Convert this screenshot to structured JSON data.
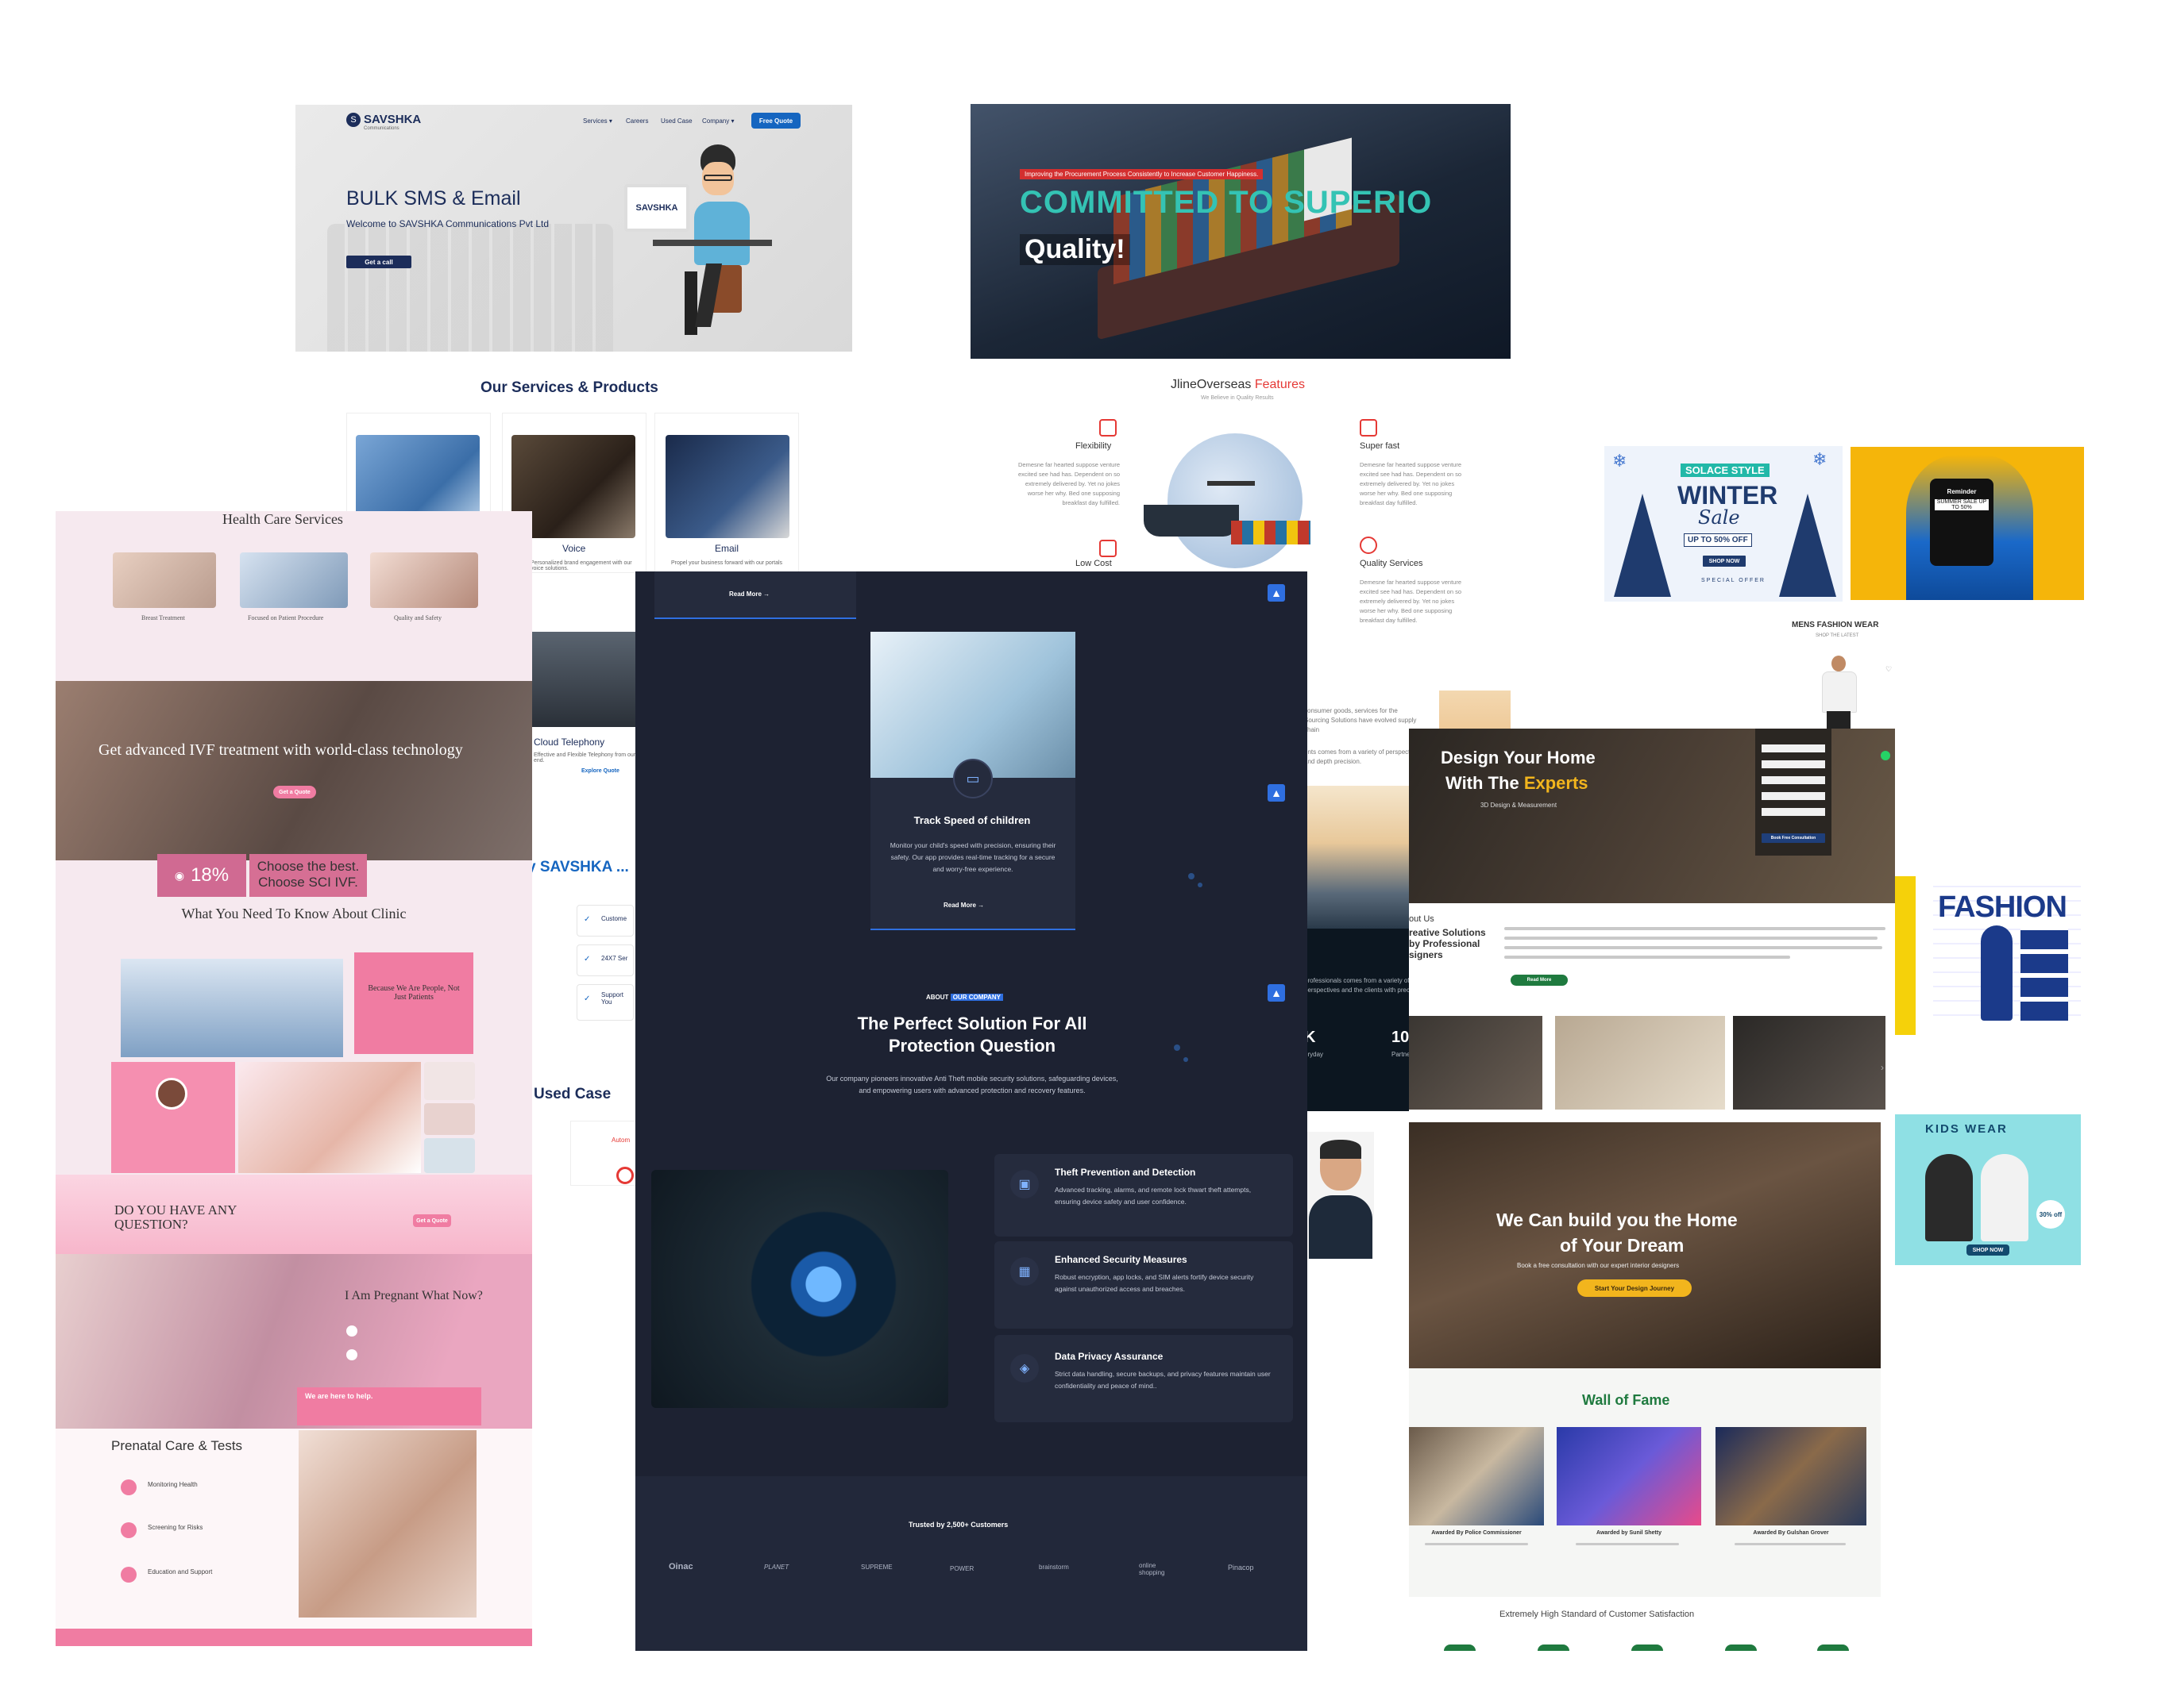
{
  "savshka": {
    "logo": "SAVSHKA",
    "logo_tagline": "Communications",
    "nav": [
      "Services ▾",
      "Careers",
      "Used Case",
      "Company ▾"
    ],
    "cta": "Free Quote",
    "hero_title": "BULK SMS & Email",
    "hero_sub": "Welcome to SAVSHKA Communications Pvt Ltd",
    "hero_btn": "Get a call",
    "monitor_logo": "SAVSHKA",
    "services_title": "Our Services & Products",
    "cards": [
      {
        "title": "Voice",
        "desc": "Personalized brand engagement with our voice solutions.",
        "link": "Explore"
      },
      {
        "title": "Email",
        "desc": "Propel your business forward with our portals"
      }
    ],
    "cloud_title": "Cloud Telephony",
    "cloud_desc": "Effective and Flexible Telephony from our end.",
    "cloud_link": "Explore Quote",
    "why_title": "y SAVSHKA ...",
    "why_items": [
      "Custome",
      "24X7 Ser",
      "Support You"
    ],
    "used_case": "Used Case",
    "auto_label": "Autom"
  },
  "shipping": {
    "badge": "Improving the Procurement Process Consistently to Increase Customer Happiness.",
    "title": "COMMITTED TO SUPERIO",
    "title2": "Quality!",
    "features_brand": "JlineOverseas",
    "features_word": "Features",
    "features_sub": "We Believe in Quality Results",
    "items": [
      {
        "title": "Flexibility",
        "desc": "Demesne far hearted suppose venture excited see had has. Dependent on so extremely delivered by. Yet no jokes worse her why. Bed one supposing breakfast day fulfilled."
      },
      {
        "title": "Super fast",
        "desc": "Demesne far hearted suppose venture excited see had has. Dependent on so extremely delivered by. Yet no jokes worse her why. Bed one supposing breakfast day fulfilled."
      },
      {
        "title": "Quality Services",
        "desc": "Demesne far hearted suppose venture excited see had has. Dependent on so extremely delivered by. Yet no jokes worse her why. Bed one supposing breakfast day fulfilled."
      },
      {
        "title": "Low Cost"
      }
    ],
    "about_text": "consumer goods, services for the Sourcing Solutions have evolved supply chain",
    "about_text2": "ents comes from a variety of perspectives and depth precision.",
    "dark_text": "professionals comes from a variety of perspectives and the clients with precision.",
    "stat_k": "K",
    "stat_k_label": "eryday",
    "stat_10": "10",
    "stat_10_label": "Partner V"
  },
  "health": {
    "title": "Health Care Services",
    "services": [
      "Breast Treatment",
      "Focused on Patient Procedure",
      "Quality and Safety"
    ],
    "ivf_title": "Get advanced IVF treatment with world-class technology",
    "ivf_btn": "Get a Quote",
    "stat": "18%",
    "choose": "Choose the best. Choose SCI IVF.",
    "know_title": "What You Need To Know About Clinic",
    "pink_box": "Because We Are People, Not Just Patients",
    "question": "DO YOU HAVE ANY QUESTION?",
    "question_btn": "Get a Quote",
    "pregnant": "I Am Pregnant What Now?",
    "help": "We are here to help.",
    "prenatal": "Prenatal Care & Tests",
    "prenatal_items": [
      "Monitoring Health",
      "Screening for Risks",
      "Education and Support"
    ]
  },
  "security": {
    "read_more_top": "Read More →",
    "card_title": "Track Speed of children",
    "card_desc": "Monitor your child's speed with precision, ensuring their safety. Our app provides real-time tracking for a secure and worry-free experience.",
    "card_link": "Read More →",
    "about_pre": "ABOUT",
    "about_hl": "OUR COMPANY",
    "title": "The Perfect Solution For All Protection Question",
    "desc": "Our company pioneers innovative Anti Theft mobile security solutions, safeguarding devices, and empowering users with advanced protection and recovery features.",
    "features": [
      {
        "title": "Theft Prevention and Detection",
        "desc": "Advanced tracking, alarms, and remote lock thwart theft attempts, ensuring device safety and user confidence."
      },
      {
        "title": "Enhanced Security Measures",
        "desc": "Robust encryption, app locks, and SIM alerts fortify device security against unauthorized access and breaches."
      },
      {
        "title": "Data Privacy Assurance",
        "desc": "Strict data handling, secure backups, and privacy features maintain user confidentiality and peace of mind.."
      }
    ],
    "trusted": "Trusted by 2,500+ Customers",
    "logos": [
      "Oinac",
      "PLANET",
      "SUPREME",
      "POWER",
      "brainstorm",
      "online shopping",
      "Pinacop"
    ]
  },
  "fashion": {
    "winter_brand": "SOLACE STYLE",
    "winter": "WINTER",
    "sale": "Sale",
    "offer": "UP TO 50% OFF",
    "shop": "SHOP NOW",
    "special": "SPECIAL OFFER",
    "reminder": "Reminder",
    "reminder_sub": "SUMMER SALE UP TO 50%",
    "mens": "MENS FASHION WEAR",
    "mens_sub": "SHOP THE LATEST",
    "fashion_word": "FASHION",
    "kids": "KIDS WEAR",
    "kids_off": "30% off",
    "kids_shop": "SHOP NOW"
  },
  "interior": {
    "title_line1": "Design Your Home",
    "title_line2": "With The",
    "title_hl": "Experts",
    "subtitle": "3D Design & Measurement",
    "form_btn": "Book Free Consultation",
    "about_head": "out Us",
    "about_sub": "reative Solutions by Professional signers",
    "read_more": "Read More",
    "hero2_line1": "We Can build you the Home",
    "hero2_line2": "of Your Dream",
    "hero2_sub": "Book a free consultation with our expert interior designers",
    "hero2_btn": "Start Your Design Journey",
    "wall": "Wall of Fame",
    "awards": [
      "Awarded By Police Commissioner",
      "Awarded by Sunil Shetty",
      "Awarded By Gulshan Grover"
    ],
    "standard": "Extremely High Standard of Customer Satisfaction"
  },
  "colors": {
    "savshka_navy": "#1c2d5a",
    "cta_blue": "#1565c0",
    "teal": "#34c3b4",
    "health_pink": "#f07ca2",
    "dark_bg": "#1d2232",
    "accent_blue": "#2f6fe0",
    "interior_green": "#1f7a3f",
    "experts_gold": "#f2b51d"
  }
}
